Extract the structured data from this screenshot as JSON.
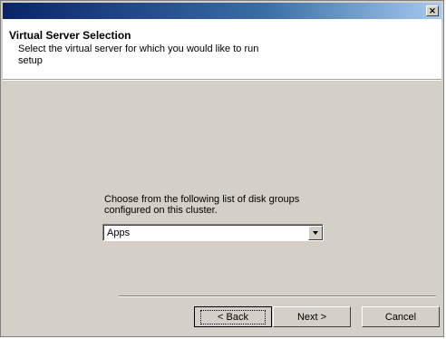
{
  "window": {
    "close_glyph": "✕"
  },
  "header": {
    "title": "Virtual Server Selection",
    "subtitle": "Select the virtual server for which you would like to run setup"
  },
  "main": {
    "prompt": "Choose from the following list of disk groups configured on this cluster.",
    "disk_group_select": {
      "selected": "Apps"
    }
  },
  "buttons": {
    "back": "< Back",
    "next": "Next >",
    "cancel": "Cancel"
  },
  "icons": {
    "close": "close-icon",
    "dropdown": "chevron-down-icon"
  }
}
